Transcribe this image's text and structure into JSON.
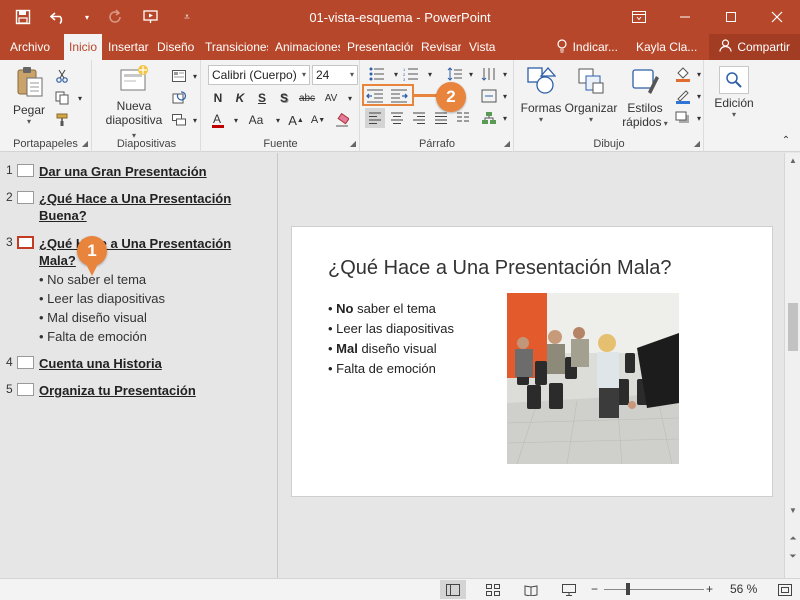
{
  "window": {
    "title": "01-vista-esquema  -  PowerPoint",
    "controls": [
      "restore-ribbon",
      "minimize",
      "maximize",
      "close"
    ]
  },
  "quick_access": [
    "save-icon",
    "undo-icon",
    "redo-icon",
    "start-presentation-icon",
    "customize-icon"
  ],
  "tabs": [
    {
      "label": "Archivo"
    },
    {
      "label": "Inicio",
      "active": true
    },
    {
      "label": "Insertar"
    },
    {
      "label": "Diseño"
    },
    {
      "label": "Transiciones"
    },
    {
      "label": "Animaciones"
    },
    {
      "label": "Presentación"
    },
    {
      "label": "Revisar"
    },
    {
      "label": "Vista"
    }
  ],
  "tell_me": "Indicar...",
  "user": "Kayla Cla...",
  "share": "Compartir",
  "ribbon": {
    "groups": {
      "clipboard": "Portapapeles",
      "slides": "Diapositivas",
      "font": "Fuente",
      "paragraph": "Párrafo",
      "drawing": "Dibujo"
    },
    "paste": "Pegar",
    "new_slide_line1": "Nueva",
    "new_slide_line2": "diapositiva",
    "font_name": "Calibri (Cuerpo)",
    "font_size": "24",
    "format": {
      "bold": "N",
      "italic": "K",
      "underline": "S",
      "shadow": "S",
      "strike": "abc",
      "spacing": "AV"
    },
    "shapes": "Formas",
    "arrange": "Organizar",
    "quick_styles_line1": "Estilos",
    "quick_styles_line2": "rápidos",
    "editing": "Edición"
  },
  "callouts": {
    "one": "1",
    "two": "2"
  },
  "accent_color": "#b7472a",
  "callout_color": "#e9843c",
  "outline": {
    "slides": [
      {
        "num": "1",
        "title": "Dar una Gran Presentación",
        "bullets": []
      },
      {
        "num": "2",
        "title_line1": "¿Qué Hace a Una Presentación",
        "title_line2": "Buena?",
        "bullets": []
      },
      {
        "num": "3",
        "title_line1": "¿Qué Hace a Una Presentación",
        "title_line2": "Mala?",
        "selected": true,
        "bullets": [
          "No saber el tema",
          "Leer las diapositivas",
          "Mal diseño visual",
          "Falta de emoción"
        ]
      },
      {
        "num": "4",
        "title": "Cuenta una Historia",
        "bullets": []
      },
      {
        "num": "5",
        "title": "Organiza tu Presentación",
        "bullets": []
      }
    ]
  },
  "slide": {
    "title": "¿Qué Hace a Una Presentación Mala?",
    "bullets": [
      {
        "bold": "No",
        "rest": " saber el tema"
      },
      {
        "bold": "",
        "rest": "Leer las diapositivas"
      },
      {
        "bold": "Mal",
        "rest": " diseño visual"
      },
      {
        "bold": "",
        "rest": "Falta de emoción"
      }
    ]
  },
  "status": {
    "zoom": "56 %",
    "zoom_minus": "−",
    "zoom_plus": "+"
  }
}
